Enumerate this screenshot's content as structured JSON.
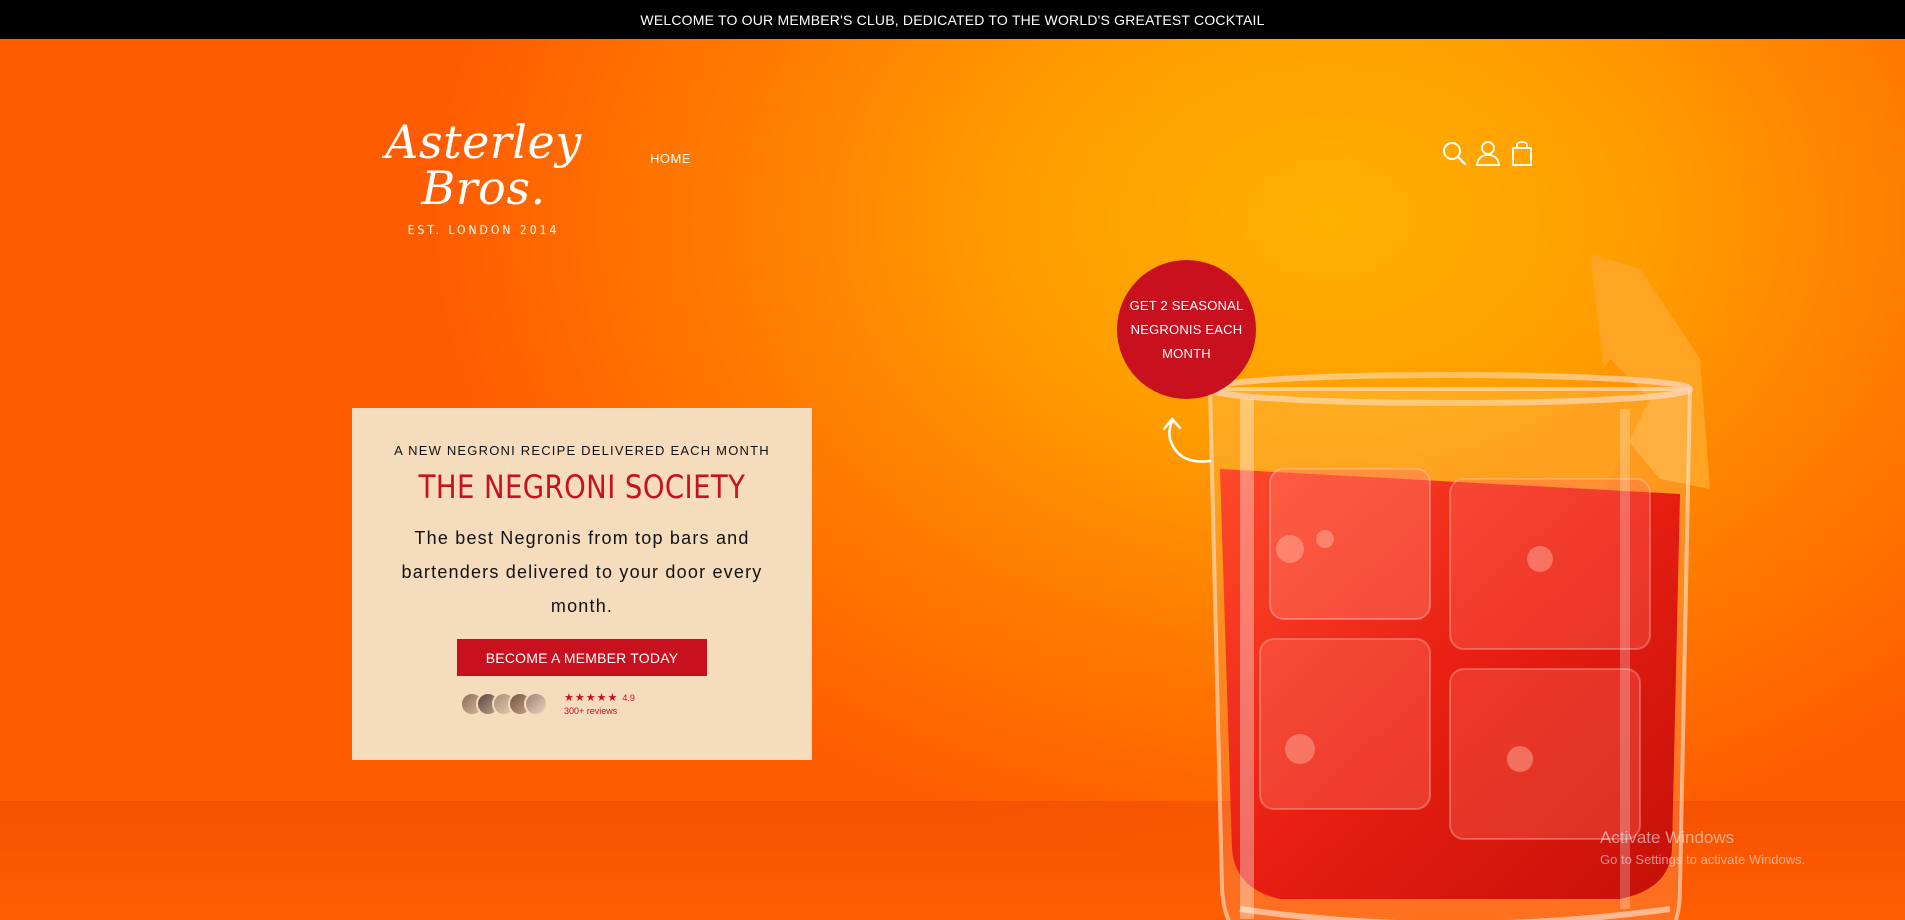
{
  "announcement": "WELCOME TO OUR MEMBER'S CLUB, DEDICATED TO THE WORLD'S GREATEST COCKTAIL",
  "header": {
    "logo_script": "Asterley Bros.",
    "logo_subtitle": "EST. LONDON 2014",
    "nav": {
      "home": "HOME"
    },
    "icons": [
      "search-icon",
      "account-icon",
      "cart-icon"
    ]
  },
  "hero": {
    "badge": "GET 2 SEASONAL NEGRONIS EACH MONTH",
    "card": {
      "kicker": "A NEW NEGRONI RECIPE DELIVERED EACH MONTH",
      "title": "THE NEGRONI SOCIETY",
      "description": "The best Negronis from top bars and bartenders delivered to your door every month.",
      "cta": "BECOME A MEMBER TODAY",
      "rating": {
        "stars": "★★★★★",
        "score": "4.9",
        "reviews": "300+ reviews"
      }
    }
  },
  "watermark": {
    "title": "Activate Windows",
    "subtitle": "Go to Settings to activate Windows."
  },
  "colors": {
    "accent": "#c8101e",
    "card_bg": "#f5dcbc",
    "announce_bg": "#000000"
  }
}
